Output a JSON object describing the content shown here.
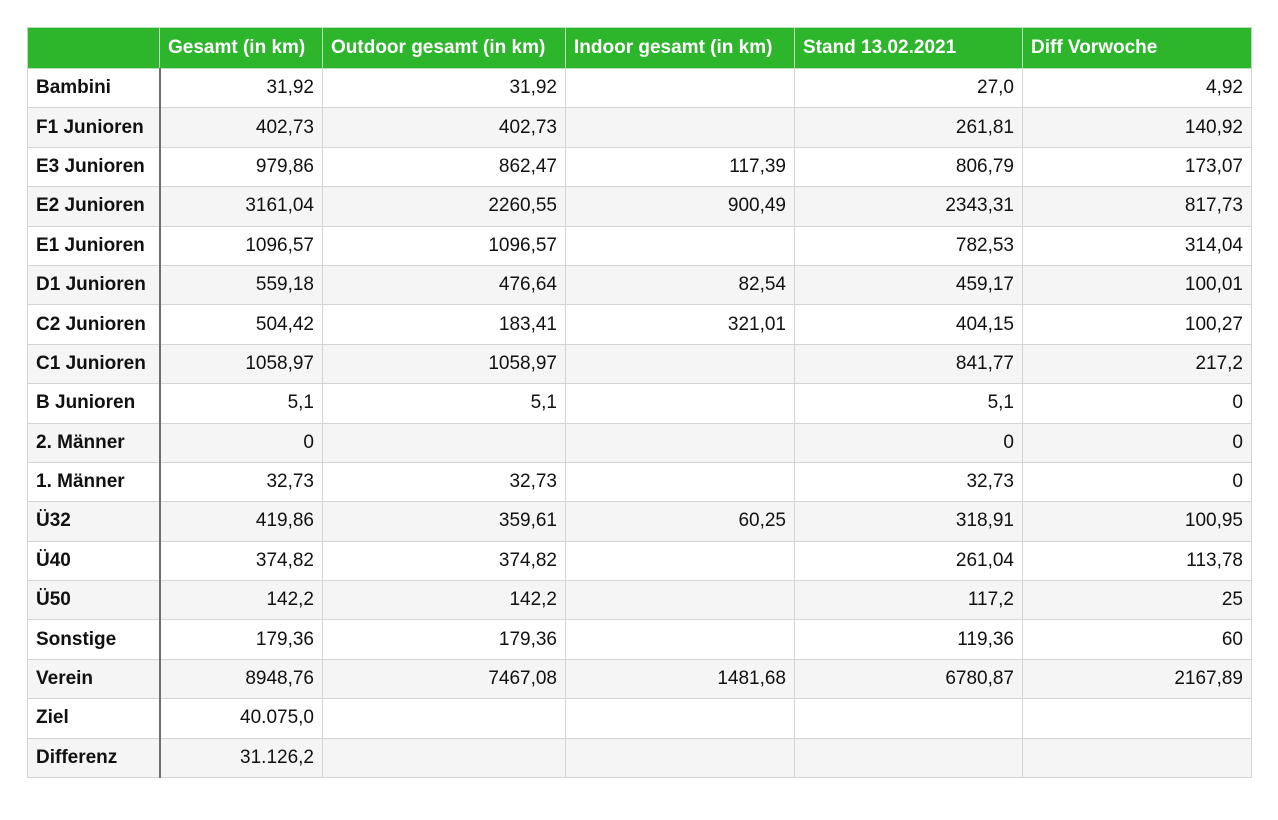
{
  "table": {
    "headers": [
      "",
      "Gesamt (in km)",
      "Outdoor gesamt (in km)",
      "Indoor gesamt (in km)",
      "Stand 13.02.2021",
      "Diff Vorwoche"
    ],
    "rows": [
      [
        "Bambini",
        "31,92",
        "31,92",
        "",
        "27,0",
        "4,92"
      ],
      [
        "F1 Junioren",
        "402,73",
        "402,73",
        "",
        "261,81",
        "140,92"
      ],
      [
        "E3 Junioren",
        "979,86",
        "862,47",
        "117,39",
        "806,79",
        "173,07"
      ],
      [
        "E2 Junioren",
        "3161,04",
        "2260,55",
        "900,49",
        "2343,31",
        "817,73"
      ],
      [
        "E1 Junioren",
        "1096,57",
        "1096,57",
        "",
        "782,53",
        "314,04"
      ],
      [
        "D1 Junioren",
        "559,18",
        "476,64",
        "82,54",
        "459,17",
        "100,01"
      ],
      [
        "C2 Junioren",
        "504,42",
        "183,41",
        "321,01",
        "404,15",
        "100,27"
      ],
      [
        "C1 Junioren",
        "1058,97",
        "1058,97",
        "",
        "841,77",
        "217,2"
      ],
      [
        "B Junioren",
        "5,1",
        "5,1",
        "",
        "5,1",
        "0"
      ],
      [
        "2. Männer",
        "0",
        "",
        "",
        "0",
        "0"
      ],
      [
        "1. Männer",
        "32,73",
        "32,73",
        "",
        "32,73",
        "0"
      ],
      [
        "Ü32",
        "419,86",
        "359,61",
        "60,25",
        "318,91",
        "100,95"
      ],
      [
        "Ü40",
        "374,82",
        "374,82",
        "",
        "261,04",
        "113,78"
      ],
      [
        "Ü50",
        "142,2",
        "142,2",
        "",
        "117,2",
        "25"
      ],
      [
        "Sonstige",
        "179,36",
        "179,36",
        "",
        "119,36",
        "60"
      ],
      [
        "Verein",
        "8948,76",
        "7467,08",
        "1481,68",
        "6780,87",
        "2167,89"
      ],
      [
        "Ziel",
        "40.075,0",
        "",
        "",
        "",
        ""
      ],
      [
        "Differenz",
        "31.126,2",
        "",
        "",
        "",
        ""
      ]
    ]
  },
  "colors": {
    "header_bg": "#2db52b",
    "header_text": "#ffffff",
    "stripe": "#f5f5f5",
    "grid": "#d4d4d4"
  }
}
